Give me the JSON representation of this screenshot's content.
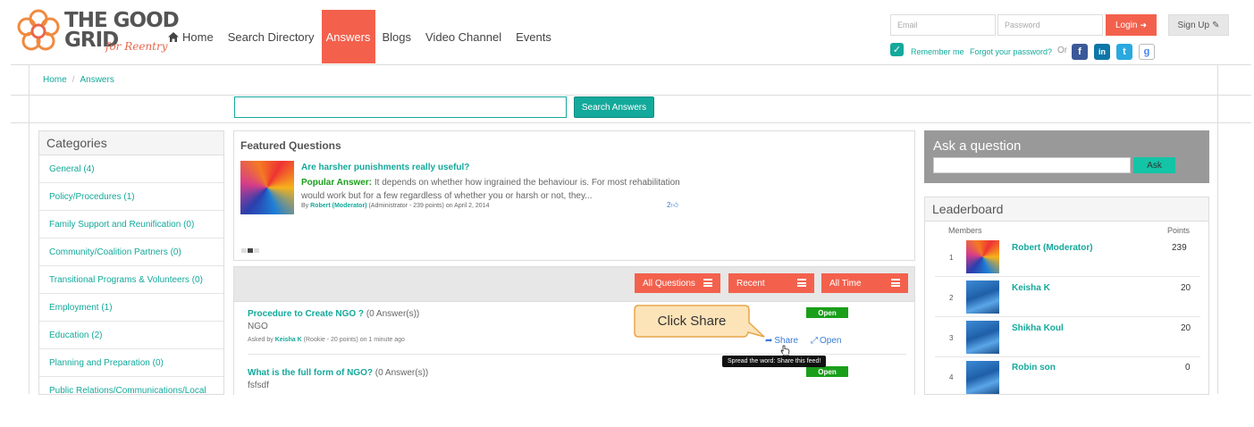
{
  "header": {
    "logo": {
      "line1": "THE GOOD",
      "line2": "GRID",
      "sub": "for Reentry"
    },
    "nav": [
      "Home",
      "Search Directory",
      "Answers",
      "Blogs",
      "Video Channel",
      "Events"
    ],
    "active_nav": "Answers",
    "email_placeholder": "Email",
    "password_placeholder": "Password",
    "login_label": "Login",
    "signup_label": "Sign Up",
    "remember_label": "Remember me",
    "forgot_label": "Forgot your password?",
    "or_label": "Or"
  },
  "breadcrumb": {
    "home": "Home",
    "sep": "/",
    "current": "Answers"
  },
  "search": {
    "button": "Search Answers",
    "value": ""
  },
  "categories": {
    "title": "Categories",
    "items": [
      "General (4)",
      "Policy/Procedures (1)",
      "Family Support and Reunification (0)",
      "Community/Coalition Partners (0)",
      "Transitional Programs & Volunteers (0)",
      "Employment (1)",
      "Education (2)",
      "Planning and Preparation (0)",
      "Public Relations/Communications/Local"
    ]
  },
  "featured": {
    "title": "Featured Questions",
    "question": "Are harsher punishments really useful?",
    "popular_label": "Popular Answer:",
    "answer_line1": "It depends on whether how ingrained the behaviour is. For most rehabilitation",
    "answer_line2": "would work but for a few regardless of whether you or harsh or not, they...",
    "by": "By",
    "author": "Robert (Moderator)",
    "meta": "(Administrator - 239 points)  on April 2, 2014",
    "likes": "2"
  },
  "filters": [
    "All Questions",
    "Recent",
    "All Time"
  ],
  "questions": [
    {
      "title": "Procedure to Create NGO ?",
      "answers": "(0 Answer(s))",
      "body": "NGO",
      "asked_by": "Asked by",
      "author": "Keisha K",
      "meta": "(Rookie - 20 points) on 1 minute ago",
      "status": "Open"
    },
    {
      "title": "What is the full form of NGO?",
      "answers": "(0 Answer(s))",
      "body": "fsfsdf",
      "status": "Open"
    }
  ],
  "actions": {
    "share": "Share",
    "open": "Open"
  },
  "tooltip": "Spread the word: Share this feed!",
  "callout": "Click Share",
  "ask": {
    "title": "Ask a question",
    "button": "Ask",
    "value": ""
  },
  "leaderboard": {
    "title": "Leaderboard",
    "members_label": "Members",
    "points_label": "Points",
    "rows": [
      {
        "rank": "1",
        "name": "Robert (Moderator)",
        "points": "239"
      },
      {
        "rank": "2",
        "name": "Keisha K",
        "points": "20"
      },
      {
        "rank": "3",
        "name": "Shikha Koul",
        "points": "20"
      },
      {
        "rank": "4",
        "name": "Robin son",
        "points": "0"
      }
    ]
  },
  "colors": {
    "accent": "#f3614d",
    "teal": "#13a99b",
    "open_green": "#1a9f1a",
    "ask_panel": "#999999"
  }
}
